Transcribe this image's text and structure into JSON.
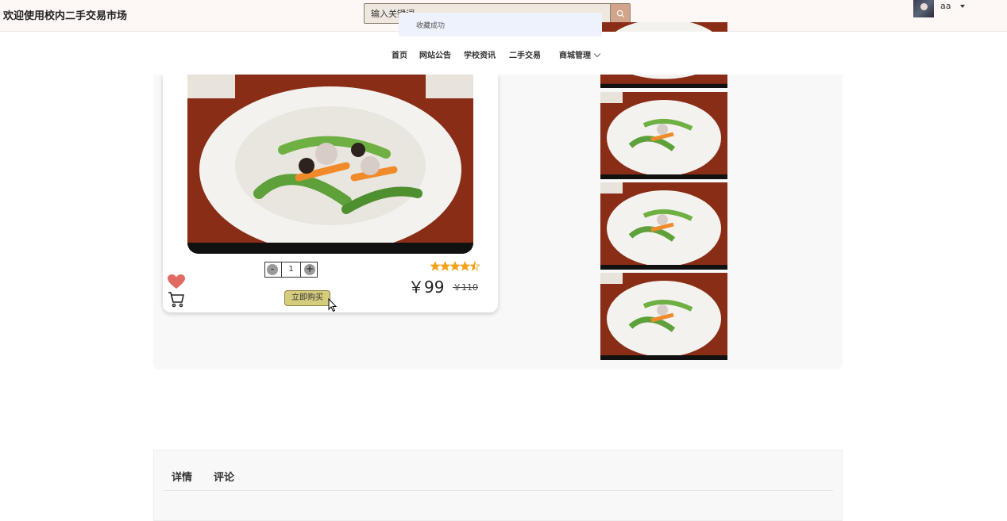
{
  "header": {
    "site_title": "欢迎使用校内二手交易市场",
    "search_placeholder": "输入关键词",
    "toast": "收藏成功",
    "username": "aa"
  },
  "nav": {
    "items": [
      {
        "label": "首页"
      },
      {
        "label": "网站公告"
      },
      {
        "label": "学校资讯"
      },
      {
        "label": "二手交易"
      },
      {
        "label": "商城管理"
      }
    ]
  },
  "product": {
    "quantity": "1",
    "decrement": "-",
    "increment": "+",
    "buy_label": "立即购买",
    "rating": 4.5,
    "rating_max": 5,
    "price": "￥99",
    "original_price": "￥110",
    "heart_color": "#e06b62",
    "star_color": "#f2a21a"
  },
  "tabs": [
    {
      "label": "详情"
    },
    {
      "label": "评论"
    }
  ]
}
